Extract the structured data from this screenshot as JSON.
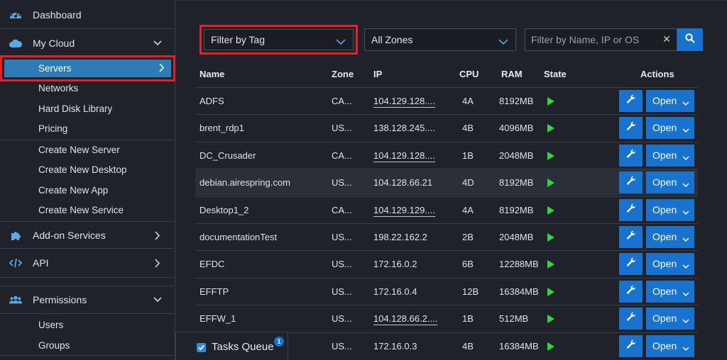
{
  "sidebar": {
    "dashboard": {
      "label": "Dashboard",
      "icon": "dashboard-gauge-icon"
    },
    "my_cloud": {
      "label": "My Cloud",
      "icon": "cloud-icon"
    },
    "servers": {
      "label": "Servers"
    },
    "networks": {
      "label": "Networks"
    },
    "hard_disk_library": {
      "label": "Hard Disk Library"
    },
    "pricing": {
      "label": "Pricing"
    },
    "create_new_server": {
      "label": "Create New Server"
    },
    "create_new_desktop": {
      "label": "Create New Desktop"
    },
    "create_new_app": {
      "label": "Create New App"
    },
    "create_new_service": {
      "label": "Create New Service"
    },
    "addon_services": {
      "label": "Add-on Services",
      "icon": "puzzle-icon"
    },
    "api": {
      "label": "API",
      "icon": "code-icon"
    },
    "permissions": {
      "label": "Permissions",
      "icon": "users-icon"
    },
    "users": {
      "label": "Users"
    },
    "groups": {
      "label": "Groups"
    }
  },
  "filters": {
    "tag": "Filter by Tag",
    "zones": "All Zones",
    "search_placeholder": "Filter by Name, IP or OS"
  },
  "table": {
    "headers": {
      "name": "Name",
      "zone": "Zone",
      "ip": "IP",
      "cpu": "CPU",
      "ram": "RAM",
      "state": "State",
      "actions": "Actions"
    },
    "open_label": "Open",
    "rows": [
      {
        "name": "ADFS",
        "zone": "CA...",
        "ip": "104.129.128....",
        "cpu": "4A",
        "ram": "8192MB"
      },
      {
        "name": "brent_rdp1",
        "zone": "US...",
        "ip": "138.128.245....",
        "cpu": "4B",
        "ram": "4096MB"
      },
      {
        "name": "DC_Crusader",
        "zone": "CA...",
        "ip": "104.129.128....",
        "cpu": "1B",
        "ram": "2048MB"
      },
      {
        "name": "debian.airespring.com",
        "zone": "US...",
        "ip": "104.128.66.21",
        "cpu": "4D",
        "ram": "8192MB"
      },
      {
        "name": "Desktop1_2",
        "zone": "CA...",
        "ip": "104.129.129....",
        "cpu": "4A",
        "ram": "8192MB"
      },
      {
        "name": "documentationTest",
        "zone": "US...",
        "ip": "198.22.162.2",
        "cpu": "2B",
        "ram": "2048MB"
      },
      {
        "name": "EFDC",
        "zone": "US...",
        "ip": "172.16.0.2",
        "cpu": "6B",
        "ram": "12288MB"
      },
      {
        "name": "EFFTP",
        "zone": "US...",
        "ip": "172.16.0.4",
        "cpu": "12B",
        "ram": "16384MB"
      },
      {
        "name": "EFFW_1",
        "zone": "US...",
        "ip": "104.128.66.2....",
        "cpu": "1B",
        "ram": "512MB"
      },
      {
        "name": "",
        "zone": "US...",
        "ip": "172.16.0.3",
        "cpu": "4B",
        "ram": "16384MB"
      }
    ]
  },
  "tasks_queue": {
    "label": "Tasks Queue",
    "count": "1"
  },
  "colors": {
    "accent": "#1873cf",
    "highlight_red": "#e32129",
    "active_nav": "#2d7bb7",
    "state_running": "#2bd83e"
  }
}
